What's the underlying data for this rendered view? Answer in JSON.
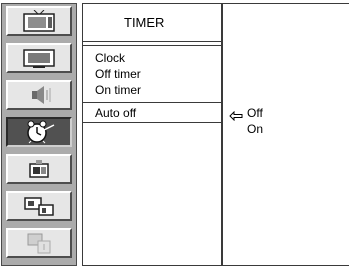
{
  "sidebar": {
    "items": [
      {
        "icon": "picture-icon",
        "selected": false
      },
      {
        "icon": "screen-icon",
        "selected": false
      },
      {
        "icon": "audio-icon",
        "selected": false
      },
      {
        "icon": "timer-clock-icon",
        "selected": true
      },
      {
        "icon": "special-icon",
        "selected": false
      },
      {
        "icon": "pip-icon",
        "selected": false
      },
      {
        "icon": "setup-icon",
        "selected": false
      }
    ]
  },
  "menu": {
    "title": "TIMER",
    "items": [
      {
        "label": "Clock"
      },
      {
        "label": "Off timer"
      },
      {
        "label": "On timer"
      },
      {
        "label": "Auto off"
      }
    ]
  },
  "submenu": {
    "options": [
      {
        "label": "Off",
        "selected": true
      },
      {
        "label": "On",
        "selected": false
      }
    ]
  },
  "colors": {
    "sidebar_bg": "#ababab",
    "tile_bg": "#e6e6e6",
    "tile_selected_bg": "#515151"
  }
}
